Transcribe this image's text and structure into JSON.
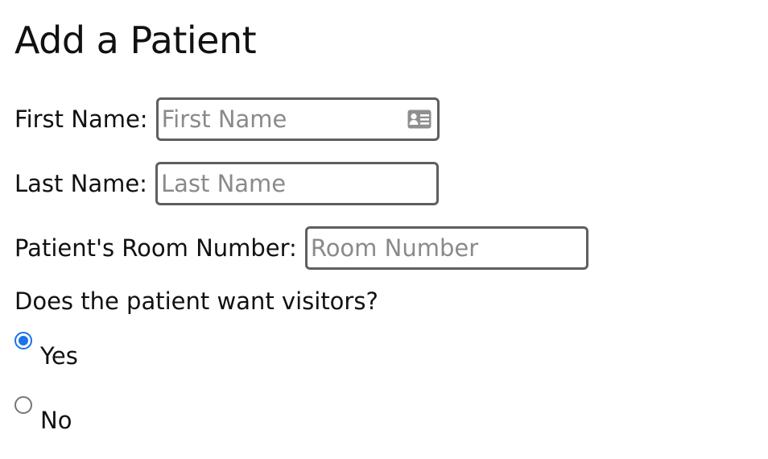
{
  "page": {
    "title": "Add a Patient"
  },
  "form": {
    "first_name": {
      "label": "First Name:",
      "placeholder": "First Name",
      "value": "",
      "icon": "contact-card-icon"
    },
    "last_name": {
      "label": "Last Name:",
      "placeholder": "Last Name",
      "value": ""
    },
    "room_number": {
      "label": "Patient's Room Number:",
      "placeholder": "Room Number",
      "value": ""
    },
    "visitors": {
      "question": "Does the patient want visitors?",
      "options": [
        {
          "label": "Yes",
          "checked": true
        },
        {
          "label": "No",
          "checked": false
        }
      ]
    }
  },
  "colors": {
    "accent": "#1a73e8",
    "input_border": "#5f5f5f",
    "placeholder": "#8a8a8a",
    "text": "#111111"
  }
}
